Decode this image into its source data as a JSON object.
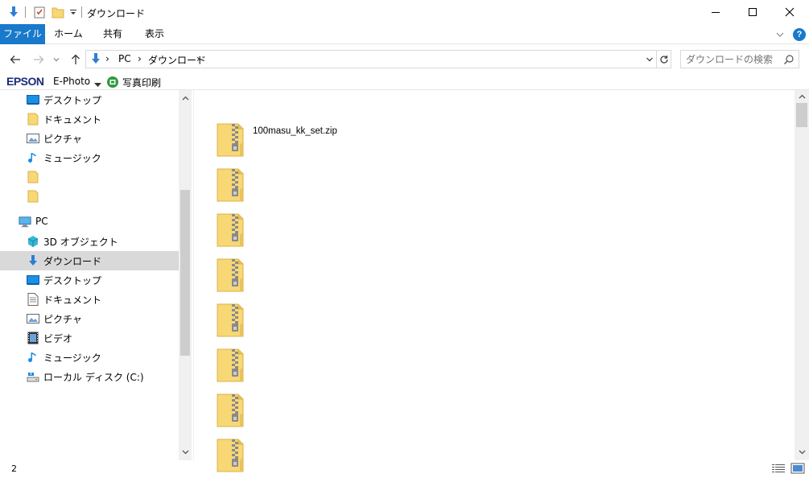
{
  "window": {
    "title": "ダウンロード"
  },
  "ribbon": {
    "tabs": [
      {
        "label": "ファイル"
      },
      {
        "label": "ホーム"
      },
      {
        "label": "共有"
      },
      {
        "label": "表示"
      }
    ],
    "help_label": "?"
  },
  "address": {
    "crumbs": [
      "PC",
      "ダウンロード"
    ],
    "search_placeholder": "ダウンロードの検索"
  },
  "epson": {
    "logo": "EPSON",
    "app_label": "E-Photo",
    "print_label": "写真印刷"
  },
  "nav": {
    "items": [
      {
        "label": "デスクトップ",
        "icon": "desktop-icon"
      },
      {
        "label": "ドキュメント",
        "icon": "folder-icon"
      },
      {
        "label": "ピクチャ",
        "icon": "pictures-icon"
      },
      {
        "label": "ミュージック",
        "icon": "music-icon"
      },
      {
        "label": "",
        "icon": "folder-icon"
      },
      {
        "label": "",
        "icon": "folder-icon"
      },
      {
        "label": "PC",
        "icon": "pc-icon"
      },
      {
        "label": "3D オブジェクト",
        "icon": "3d-objects-icon"
      },
      {
        "label": "ダウンロード",
        "icon": "download-icon"
      },
      {
        "label": "デスクトップ",
        "icon": "desktop-icon"
      },
      {
        "label": "ドキュメント",
        "icon": "document-icon"
      },
      {
        "label": "ピクチャ",
        "icon": "pictures-icon"
      },
      {
        "label": "ビデオ",
        "icon": "video-icon"
      },
      {
        "label": "ミュージック",
        "icon": "music-icon"
      },
      {
        "label": "ローカル ディスク (C:)",
        "icon": "drive-icon"
      }
    ]
  },
  "content": {
    "files": [
      {
        "name": "100masu_kk_set.zip",
        "icon": "zip-folder-icon"
      },
      {
        "name": "",
        "icon": "zip-folder-icon"
      },
      {
        "name": "",
        "icon": "zip-folder-icon"
      },
      {
        "name": "",
        "icon": "zip-folder-icon"
      },
      {
        "name": "",
        "icon": "zip-folder-icon"
      },
      {
        "name": "",
        "icon": "zip-folder-icon"
      },
      {
        "name": "",
        "icon": "zip-folder-icon"
      },
      {
        "name": "",
        "icon": "zip-folder-icon"
      }
    ]
  },
  "status": {
    "item_count": "2"
  },
  "colors": {
    "accent": "#1979ca",
    "selection": "#d9d9d9",
    "folder": "#f8d775"
  }
}
